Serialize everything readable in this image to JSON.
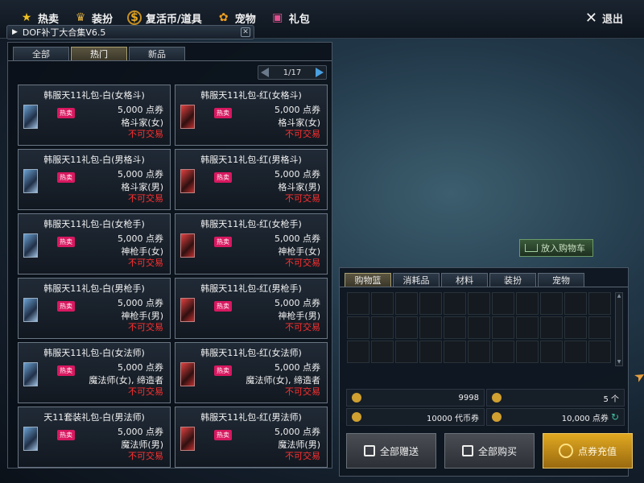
{
  "topnav": [
    {
      "label": "热卖",
      "icon": "star-icon"
    },
    {
      "label": "装扮",
      "icon": "trophy-icon"
    },
    {
      "label": "复活币/道具",
      "icon": "coin-icon"
    },
    {
      "label": "宠物",
      "icon": "paw-icon"
    },
    {
      "label": "礼包",
      "icon": "gift-icon"
    }
  ],
  "exit_label": "退出",
  "window_title": "DOF补丁大合集V6.5",
  "tabs": [
    "全部",
    "热门",
    "新品"
  ],
  "active_tab": "热门",
  "pager": "1/17",
  "items": [
    {
      "name": "韩服天11礼包-白(女格斗)",
      "badge": "热卖",
      "price": "5,000 点券",
      "cls": "格斗家(女)",
      "trade": "不可交易",
      "color": "white"
    },
    {
      "name": "韩服天11礼包-红(女格斗)",
      "badge": "热卖",
      "price": "5,000 点券",
      "cls": "格斗家(女)",
      "trade": "不可交易",
      "color": "red"
    },
    {
      "name": "韩服天11礼包-白(男格斗)",
      "badge": "热卖",
      "price": "5,000 点券",
      "cls": "格斗家(男)",
      "trade": "不可交易",
      "color": "white"
    },
    {
      "name": "韩服天11礼包-红(男格斗)",
      "badge": "热卖",
      "price": "5,000 点券",
      "cls": "格斗家(男)",
      "trade": "不可交易",
      "color": "red"
    },
    {
      "name": "韩服天11礼包-白(女枪手)",
      "badge": "热卖",
      "price": "5,000 点券",
      "cls": "神枪手(女)",
      "trade": "不可交易",
      "color": "white"
    },
    {
      "name": "韩服天11礼包-红(女枪手)",
      "badge": "热卖",
      "price": "5,000 点券",
      "cls": "神枪手(女)",
      "trade": "不可交易",
      "color": "red"
    },
    {
      "name": "韩服天11礼包-白(男枪手)",
      "badge": "热卖",
      "price": "5,000 点券",
      "cls": "神枪手(男)",
      "trade": "不可交易",
      "color": "white"
    },
    {
      "name": "韩服天11礼包-红(男枪手)",
      "badge": "热卖",
      "price": "5,000 点券",
      "cls": "神枪手(男)",
      "trade": "不可交易",
      "color": "red"
    },
    {
      "name": "韩服天11礼包-白(女法师)",
      "badge": "热卖",
      "price": "5,000 点券",
      "cls": "魔法师(女), 缔造者",
      "trade": "不可交易",
      "color": "white"
    },
    {
      "name": "韩服天11礼包-红(女法师)",
      "badge": "热卖",
      "price": "5,000 点券",
      "cls": "魔法师(女), 缔造者",
      "trade": "不可交易",
      "color": "red"
    },
    {
      "name": "天11套装礼包-白(男法师)",
      "badge": "热卖",
      "price": "5,000 点券",
      "cls": "魔法师(男)",
      "trade": "不可交易",
      "color": "white"
    },
    {
      "name": "韩服天11礼包-红(男法师)",
      "badge": "热卖",
      "price": "5,000 点券",
      "cls": "魔法师(男)",
      "trade": "不可交易",
      "color": "red"
    }
  ],
  "add_to_cart": "放入购物车",
  "cart_tabs": [
    "购物篮",
    "消耗品",
    "材料",
    "装扮",
    "宠物"
  ],
  "active_cart_tab": "购物篮",
  "info": {
    "gold": "9998",
    "count": "5 个",
    "tokens": "10000 代币券",
    "points": "10,000 点券"
  },
  "buttons": {
    "gift_all": "全部赠送",
    "buy_all": "全部购买",
    "recharge": "点券充值"
  }
}
